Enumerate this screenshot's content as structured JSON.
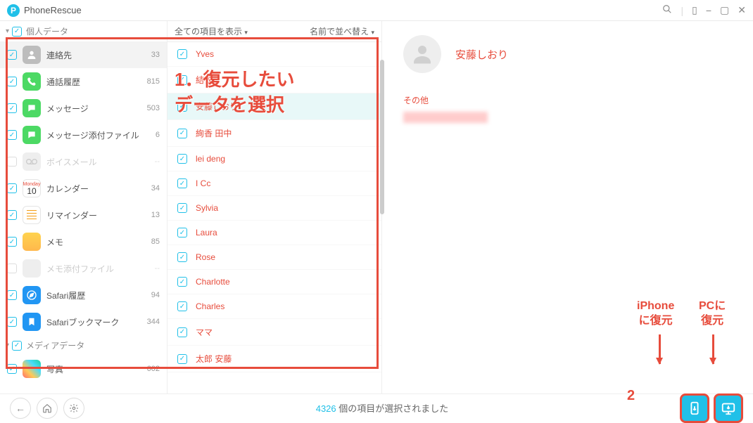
{
  "app": {
    "title": "PhoneRescue"
  },
  "titlebar": {
    "search_icon": "search",
    "layout_icon": "layout",
    "min": "−",
    "restore": "▢",
    "close": "✕"
  },
  "sidebar": {
    "categories": [
      {
        "label": "個人データ",
        "items_key": "personal"
      },
      {
        "label": "メディアデータ",
        "items_key": "media"
      }
    ],
    "personal": [
      {
        "label": "連絡先",
        "count": "33",
        "icon": "contacts",
        "checked": true,
        "selected": true
      },
      {
        "label": "通話履歴",
        "count": "815",
        "icon": "calls",
        "checked": true
      },
      {
        "label": "メッセージ",
        "count": "503",
        "icon": "messages",
        "checked": true
      },
      {
        "label": "メッセージ添付ファイル",
        "count": "6",
        "icon": "attach",
        "checked": true
      },
      {
        "label": "ボイスメール",
        "count": "--",
        "icon": "voicemail",
        "disabled": true
      },
      {
        "label": "カレンダー",
        "count": "34",
        "icon": "calendar",
        "checked": true
      },
      {
        "label": "リマインダー",
        "count": "13",
        "icon": "reminder",
        "checked": true
      },
      {
        "label": "メモ",
        "count": "85",
        "icon": "memo",
        "checked": true
      },
      {
        "label": "メモ添付ファイル",
        "count": "--",
        "icon": "memoattach",
        "disabled": true
      },
      {
        "label": "Safari履歴",
        "count": "94",
        "icon": "safari-history",
        "checked": true
      },
      {
        "label": "Safariブックマーク",
        "count": "344",
        "icon": "safari-bookmark",
        "checked": true
      }
    ],
    "media": [
      {
        "label": "写真",
        "count": "602",
        "icon": "photos",
        "checked": true
      }
    ]
  },
  "middle": {
    "view_label": "全ての項目を表示",
    "sort_label": "名前で並べ替え",
    "contacts": [
      {
        "name": "Yves"
      },
      {
        "name": "結衣"
      },
      {
        "name": "安藤しおり",
        "selected": true
      },
      {
        "name": "絢香 田中"
      },
      {
        "name": "lei deng"
      },
      {
        "name": "I Cc"
      },
      {
        "name": "Sylvia"
      },
      {
        "name": "Laura"
      },
      {
        "name": "Rose"
      },
      {
        "name": "Charlotte"
      },
      {
        "name": "Charles"
      },
      {
        "name": "ママ"
      },
      {
        "name": "太郎 安藤"
      }
    ]
  },
  "detail": {
    "name": "安藤しおり",
    "section_label": "その他"
  },
  "footer": {
    "count": "4326",
    "suffix": "個の項目が選択されました"
  },
  "annotations": {
    "step1": "1．復元したい\nデータを選択",
    "step2_num": "2",
    "iphone_label": "iPhone\nに復元",
    "pc_label": "PCに\n復元"
  }
}
